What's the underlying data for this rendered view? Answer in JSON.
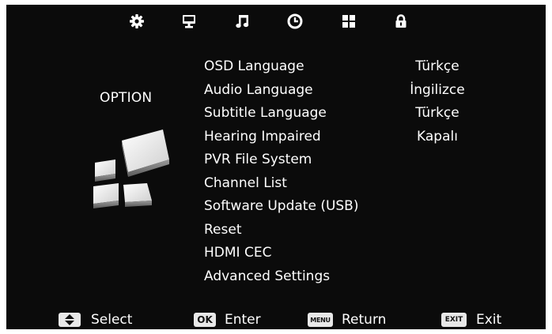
{
  "top_icons": [
    {
      "name": "settings-gear-icon"
    },
    {
      "name": "picture-monitor-icon"
    },
    {
      "name": "sound-note-icon"
    },
    {
      "name": "time-clock-icon"
    },
    {
      "name": "setup-grid-icon"
    },
    {
      "name": "lock-icon"
    }
  ],
  "section": {
    "title": "OPTION"
  },
  "menu": {
    "items": [
      {
        "label": "OSD Language",
        "value": "Türkçe"
      },
      {
        "label": "Audio Language",
        "value": "İngilizce"
      },
      {
        "label": "Subtitle Language",
        "value": "Türkçe"
      },
      {
        "label": "Hearing Impaired",
        "value": "Kapalı"
      },
      {
        "label": "PVR File System",
        "value": ""
      },
      {
        "label": "Channel List",
        "value": ""
      },
      {
        "label": "Software Update (USB)",
        "value": ""
      },
      {
        "label": "Reset",
        "value": ""
      },
      {
        "label": "HDMI CEC",
        "value": ""
      },
      {
        "label": "Advanced Settings",
        "value": ""
      }
    ]
  },
  "footer": {
    "select": {
      "key": "",
      "label": "Select"
    },
    "enter": {
      "key": "OK",
      "label": "Enter"
    },
    "return": {
      "key": "MENU",
      "label": "Return"
    },
    "exit": {
      "key": "EXIT",
      "label": "Exit"
    }
  },
  "colors": {
    "background": "#0b0b0b",
    "text": "#ffffff",
    "key_bg": "#e8e8e8"
  }
}
